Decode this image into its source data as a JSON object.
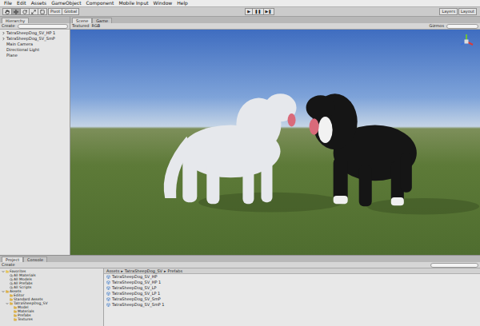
{
  "menu": [
    "File",
    "Edit",
    "Assets",
    "GameObject",
    "Component",
    "Mobile Input",
    "Window",
    "Help"
  ],
  "toolbar": {
    "pivot": "Pivot",
    "space": "Global",
    "play": [
      {
        "label": "▶",
        "selected": false
      },
      {
        "label": "❚❚",
        "selected": false
      },
      {
        "label": "▶❚",
        "selected": false
      }
    ],
    "layers": "Layers",
    "layout": "Layout"
  },
  "hierarchy": {
    "tab": "Hierarchy",
    "create": "Create",
    "items": [
      {
        "label": "TatraSheepDog_SV_HP 1",
        "expandable": true,
        "selected": false
      },
      {
        "label": "TatraSheepDog_SV_SmP",
        "expandable": true,
        "selected": false
      },
      {
        "label": "Main Camera",
        "expandable": false,
        "selected": false
      },
      {
        "label": "Directional Light",
        "expandable": false,
        "selected": false
      },
      {
        "label": "Plane",
        "expandable": false,
        "selected": false
      }
    ]
  },
  "scene": {
    "tabs": [
      {
        "label": "Scene",
        "selected": true
      },
      {
        "label": "Game",
        "selected": false
      }
    ],
    "controls": [
      "Textured",
      "RGB"
    ],
    "gizmos": "Gizmos"
  },
  "project": {
    "tabs": [
      {
        "label": "Project",
        "selected": true
      },
      {
        "label": "Console",
        "selected": false
      }
    ],
    "create": "Create",
    "tree": [
      {
        "label": "Favorites",
        "depth": 0,
        "kind": "favorite",
        "expanded": true
      },
      {
        "label": "All Materials",
        "depth": 1,
        "kind": "search",
        "expanded": false
      },
      {
        "label": "All Models",
        "depth": 1,
        "kind": "search",
        "expanded": false
      },
      {
        "label": "All Prefabs",
        "depth": 1,
        "kind": "search",
        "expanded": false
      },
      {
        "label": "All Scripts",
        "depth": 1,
        "kind": "search",
        "expanded": false
      },
      {
        "label": "Assets",
        "depth": 0,
        "kind": "folder",
        "expanded": true
      },
      {
        "label": "Editor",
        "depth": 1,
        "kind": "folder",
        "expanded": false
      },
      {
        "label": "Standard Assets",
        "depth": 1,
        "kind": "folder",
        "expanded": false
      },
      {
        "label": "TatraSheepDog_SV",
        "depth": 1,
        "kind": "folder",
        "expanded": true
      },
      {
        "label": "Model",
        "depth": 2,
        "kind": "folder",
        "expanded": false
      },
      {
        "label": "Materials",
        "depth": 2,
        "kind": "folder",
        "expanded": false
      },
      {
        "label": "Prefabs",
        "depth": 2,
        "kind": "folder",
        "expanded": false
      },
      {
        "label": "Textures",
        "depth": 2,
        "kind": "folder",
        "expanded": false
      }
    ],
    "breadcrumb": [
      "Assets",
      "TatraSheepDog_SV",
      "Prefabs"
    ],
    "separator": "▸",
    "files": [
      "TatraSheepDog_SV_HP",
      "TatraSheepDog_SV_HP 1",
      "TatraSheepDog_SV_LP",
      "TatraSheepDog_SV_LP 1",
      "TatraSheepDog_SV_SmP",
      "TatraSheepDog_SV_SmP 1"
    ]
  }
}
